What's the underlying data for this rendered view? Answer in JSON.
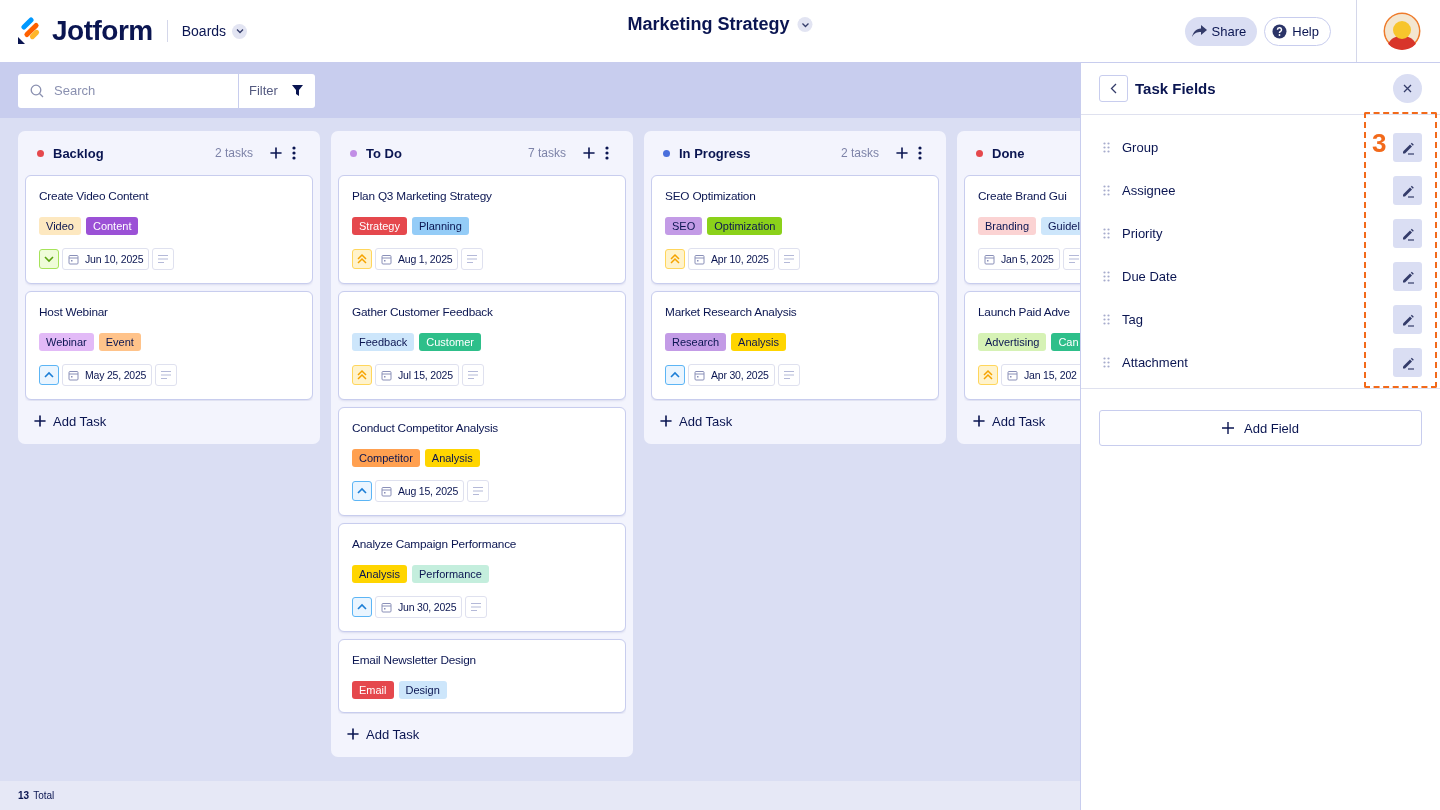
{
  "header": {
    "brand": "Jotform",
    "section": "Boards",
    "title": "Marketing Strategy",
    "buttons": [
      {
        "kind": "share",
        "label": "Share"
      },
      {
        "kind": "help",
        "label": "Help"
      }
    ]
  },
  "toolbar": {
    "search": {
      "placeholder": "Search"
    },
    "filter": "Filter"
  },
  "columns": [
    {
      "name": "Backlog",
      "color": "#e5484d",
      "count": "2 tasks",
      "add_task": "Add Task",
      "cards": [
        {
          "title": "Create Video Content",
          "tags": [
            {
              "label": "Video",
              "color": "#fde8c0"
            },
            {
              "label": "Content",
              "color": "#9b51d6"
            }
          ],
          "priority": {
            "kind": "low"
          },
          "date": "Jun 10, 2025"
        },
        {
          "title": "Host Webinar",
          "tags": [
            {
              "label": "Webinar",
              "color": "#e2baf7"
            },
            {
              "label": "Event",
              "color": "#ffc38a"
            }
          ],
          "priority": {
            "kind": "medium"
          },
          "date": "May 25, 2025"
        }
      ]
    },
    {
      "name": "To Do",
      "color": "#c18ee6",
      "count": "7 tasks",
      "add_task": "Add Task",
      "cards": [
        {
          "title": "Plan Q3 Marketing Strategy",
          "tags": [
            {
              "label": "Strategy",
              "color": "#e5484d"
            },
            {
              "label": "Planning",
              "color": "#94ccf7"
            }
          ],
          "priority": {
            "kind": "high"
          },
          "date": "Aug 1, 2025"
        },
        {
          "title": "Gather Customer Feedback",
          "tags": [
            {
              "label": "Feedback",
              "color": "#cde6fb"
            },
            {
              "label": "Customer",
              "color": "#2ebf8a"
            }
          ],
          "priority": {
            "kind": "high"
          },
          "date": "Jul 15, 2025"
        },
        {
          "title": "Conduct Competitor Analysis",
          "tags": [
            {
              "label": "Competitor",
              "color": "#ffa050"
            },
            {
              "label": "Analysis",
              "color": "#ffd500"
            }
          ],
          "priority": {
            "kind": "medium"
          },
          "date": "Aug 15, 2025"
        },
        {
          "title": "Analyze Campaign Performance",
          "tags": [
            {
              "label": "Analysis",
              "color": "#ffd500"
            },
            {
              "label": "Performance",
              "color": "#c4eedd"
            }
          ],
          "priority": {
            "kind": "medium"
          },
          "date": "Jun 30, 2025"
        },
        {
          "title": "Email Newsletter Design",
          "tags": [
            {
              "label": "Email",
              "color": "#e5484d"
            },
            {
              "label": "Design",
              "color": "#cde6fb"
            }
          ]
        }
      ]
    },
    {
      "name": "In Progress",
      "color": "#4a6fdc",
      "count": "2 tasks",
      "add_task": "Add Task",
      "cards": [
        {
          "title": "SEO Optimization",
          "tags": [
            {
              "label": "SEO",
              "color": "#c39be6"
            },
            {
              "label": "Optimization",
              "color": "#8bd11a"
            }
          ],
          "priority": {
            "kind": "high"
          },
          "date": "Apr 10, 2025"
        },
        {
          "title": "Market Research Analysis",
          "tags": [
            {
              "label": "Research",
              "color": "#c39be6"
            },
            {
              "label": "Analysis",
              "color": "#ffd500"
            }
          ],
          "priority": {
            "kind": "medium"
          },
          "date": "Apr 30, 2025"
        }
      ]
    },
    {
      "name": "Done",
      "color": "#e5484d",
      "add_task": "Add Task",
      "cards": [
        {
          "title": "Create Brand Gui",
          "tags": [
            {
              "label": "Branding",
              "color": "#fbd3d3"
            },
            {
              "label": "Guidel",
              "color": "#cde6fb"
            }
          ],
          "date": "Jan 5, 2025"
        },
        {
          "title": "Launch Paid Adve",
          "tags": [
            {
              "label": "Advertising",
              "color": "#d6f2b5"
            },
            {
              "label": "Can",
              "color": "#2ebf8a"
            }
          ],
          "priority": {
            "kind": "high"
          },
          "date": "Jan 15, 202"
        }
      ]
    }
  ],
  "footer": {
    "count": "13",
    "label": "Total"
  },
  "panel": {
    "title": "Task Fields",
    "fields": [
      "Group",
      "Assignee",
      "Priority",
      "Due Date",
      "Tag",
      "Attachment"
    ],
    "add_field": "Add Field",
    "annotation": "3"
  }
}
